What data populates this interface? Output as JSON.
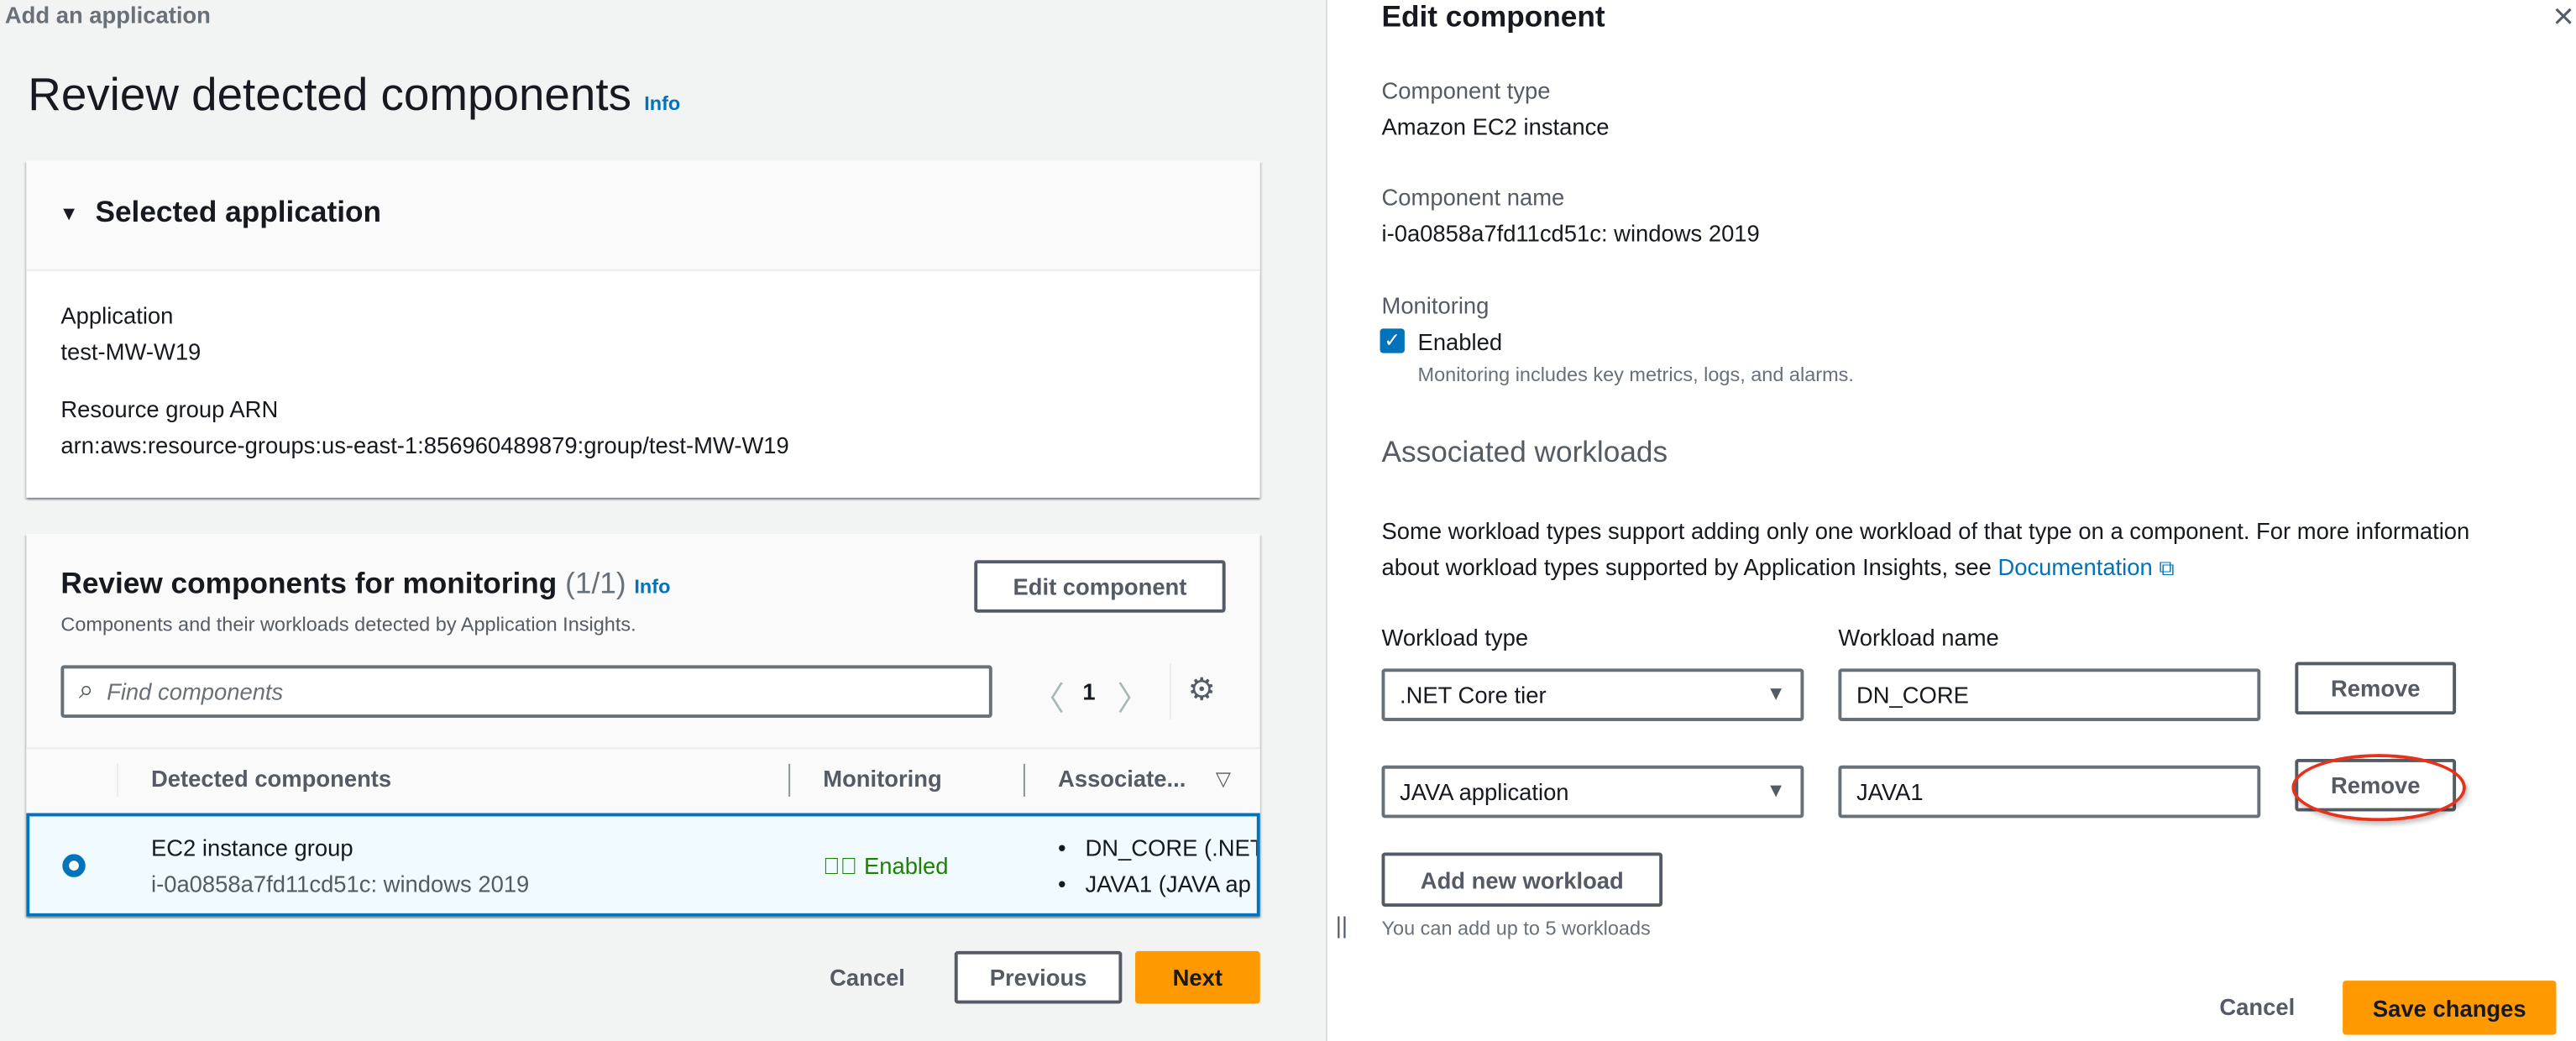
{
  "left": {
    "breadcrumb": "Add an application",
    "page_title": "Review detected components",
    "info": "Info",
    "selected_app": {
      "header": "Selected application",
      "application_label": "Application",
      "application_value": "test-MW-W19",
      "arn_label": "Resource group ARN",
      "arn_value": "arn:aws:resource-groups:us-east-1:856960489879:group/test-MW-W19"
    },
    "review": {
      "title": "Review components for monitoring",
      "count": "(1/1)",
      "info": "Info",
      "subtitle": "Components and their workloads detected by Application Insights.",
      "edit_button": "Edit component",
      "search_placeholder": "Find components",
      "page_number": "1",
      "columns": [
        "Detected components",
        "Monitoring",
        "Associate..."
      ],
      "rows": [
        {
          "name": "EC2 instance group",
          "id": "i-0a0858a7fd11cd51c: windows 2019",
          "monitoring": "Enabled",
          "workloads": [
            "DN_CORE (.NET",
            "JAVA1 (JAVA ap"
          ],
          "selected": true
        }
      ]
    },
    "footer": {
      "cancel": "Cancel",
      "previous": "Previous",
      "next": "Next"
    }
  },
  "panel": {
    "title": "Edit component",
    "close": "×",
    "component_type_label": "Component type",
    "component_type_value": "Amazon EC2 instance",
    "component_name_label": "Component name",
    "component_name_value": "i-0a0858a7fd11cd51c: windows 2019",
    "monitoring_label": "Monitoring",
    "monitoring_checkbox": "Enabled",
    "monitoring_checked": true,
    "monitoring_help": "Monitoring includes key metrics, logs, and alarms.",
    "workloads_header": "Associated workloads",
    "description_line1": "Some workload types support adding only one workload of that type on a component. For more information",
    "description_line2": "about workload types supported by Application Insights, see",
    "documentation_link": "Documentation",
    "workload_type_label": "Workload type",
    "workload_name_label": "Workload name",
    "workloads": [
      {
        "type": ".NET Core tier",
        "name": "DN_CORE",
        "remove": "Remove"
      },
      {
        "type": "JAVA application",
        "name": "JAVA1",
        "remove": "Remove",
        "highlighted": true
      }
    ],
    "add_workload": "Add new workload",
    "add_help": "You can add up to 5 workloads",
    "resize_handle": "||",
    "cancel": "Cancel",
    "save": "Save changes"
  },
  "colors": {
    "accent": "#0073bb",
    "primary": "#ff9900",
    "success": "#1d8102",
    "annotation": "#e8311a"
  }
}
